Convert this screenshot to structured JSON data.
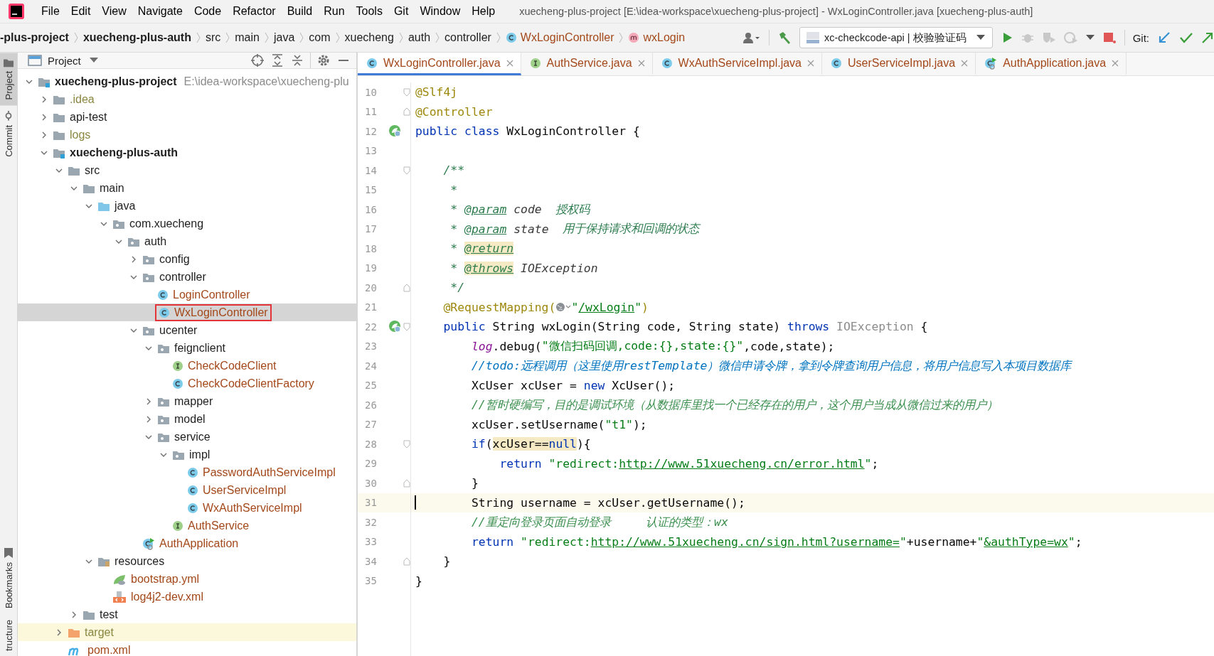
{
  "title": "xuecheng-plus-project [E:\\idea-workspace\\xuecheng-plus-project] - WxLoginController.java [xuecheng-plus-auth]",
  "menu": [
    "File",
    "Edit",
    "View",
    "Navigate",
    "Code",
    "Refactor",
    "Build",
    "Run",
    "Tools",
    "Git",
    "Window",
    "Help"
  ],
  "breadcrumbs": [
    {
      "label": "-plus-project",
      "bold": true,
      "kind": "folder"
    },
    {
      "label": "xuecheng-plus-auth",
      "bold": true,
      "kind": "folder"
    },
    {
      "label": "src",
      "bold": false,
      "kind": "folder"
    },
    {
      "label": "main",
      "bold": false,
      "kind": "folder"
    },
    {
      "label": "java",
      "bold": false,
      "kind": "folder"
    },
    {
      "label": "com",
      "bold": false,
      "kind": "folder"
    },
    {
      "label": "xuecheng",
      "bold": false,
      "kind": "folder"
    },
    {
      "label": "auth",
      "bold": false,
      "kind": "folder"
    },
    {
      "label": "controller",
      "bold": false,
      "kind": "folder"
    },
    {
      "label": "WxLoginController",
      "bold": false,
      "kind": "class"
    },
    {
      "label": "wxLogin",
      "bold": false,
      "kind": "method"
    }
  ],
  "run_config": {
    "label": "xc-checkcode-api | 校验验证码"
  },
  "git_label": "Git:",
  "tool_stripe": [
    {
      "label": "Project",
      "selected": true,
      "kind": "folder"
    },
    {
      "label": "Commit",
      "selected": false,
      "kind": "commit"
    },
    {
      "label": "Bookmarks",
      "selected": false,
      "kind": "bookmark"
    },
    {
      "label": "tructure",
      "selected": false,
      "kind": "structure"
    }
  ],
  "project_panel": {
    "title": "Project",
    "tree": [
      {
        "label": "xuecheng-plus-project",
        "path": "E:\\idea-workspace\\xuecheng-plu",
        "kind": "module",
        "bold": true,
        "ignored": false,
        "expanded": true,
        "selected": false,
        "boxed": false,
        "children": [
          {
            "label": ".idea",
            "kind": "folder",
            "bold": false,
            "ignored": true,
            "expanded": false,
            "selected": false,
            "boxed": false
          },
          {
            "label": "api-test",
            "kind": "folder",
            "bold": false,
            "ignored": false,
            "expanded": false,
            "selected": false,
            "boxed": false
          },
          {
            "label": "logs",
            "kind": "folder",
            "bold": false,
            "ignored": true,
            "expanded": false,
            "selected": false,
            "boxed": false
          },
          {
            "label": "xuecheng-plus-auth",
            "kind": "module",
            "bold": true,
            "ignored": false,
            "expanded": true,
            "selected": false,
            "boxed": false,
            "children": [
              {
                "label": "src",
                "kind": "folder",
                "bold": false,
                "ignored": false,
                "expanded": true,
                "selected": false,
                "boxed": false,
                "children": [
                  {
                    "label": "main",
                    "kind": "folder",
                    "bold": false,
                    "ignored": false,
                    "expanded": true,
                    "selected": false,
                    "boxed": false,
                    "children": [
                      {
                        "label": "java",
                        "kind": "source",
                        "bold": false,
                        "ignored": false,
                        "expanded": true,
                        "selected": false,
                        "boxed": false,
                        "children": [
                          {
                            "label": "com.xuecheng",
                            "kind": "package",
                            "bold": false,
                            "ignored": false,
                            "expanded": true,
                            "selected": false,
                            "boxed": false,
                            "children": [
                              {
                                "label": "auth",
                                "kind": "package",
                                "bold": false,
                                "ignored": false,
                                "expanded": true,
                                "selected": false,
                                "boxed": false,
                                "children": [
                                  {
                                    "label": "config",
                                    "kind": "package",
                                    "bold": false,
                                    "ignored": false,
                                    "expanded": false,
                                    "selected": false,
                                    "boxed": false
                                  },
                                  {
                                    "label": "controller",
                                    "kind": "package",
                                    "bold": false,
                                    "ignored": false,
                                    "expanded": true,
                                    "selected": false,
                                    "boxed": false,
                                    "children": [
                                      {
                                        "label": "LoginController",
                                        "kind": "class",
                                        "bold": false,
                                        "ignored": false,
                                        "selected": false,
                                        "boxed": false
                                      },
                                      {
                                        "label": "WxLoginController",
                                        "kind": "class",
                                        "bold": false,
                                        "ignored": false,
                                        "selected": true,
                                        "boxed": true
                                      }
                                    ]
                                  },
                                  {
                                    "label": "ucenter",
                                    "kind": "package",
                                    "bold": false,
                                    "ignored": false,
                                    "expanded": true,
                                    "selected": false,
                                    "boxed": false,
                                    "children": [
                                      {
                                        "label": "feignclient",
                                        "kind": "package",
                                        "bold": false,
                                        "ignored": false,
                                        "expanded": true,
                                        "selected": false,
                                        "boxed": false,
                                        "children": [
                                          {
                                            "label": "CheckCodeClient",
                                            "kind": "interface",
                                            "bold": false,
                                            "ignored": false,
                                            "selected": false,
                                            "boxed": false
                                          },
                                          {
                                            "label": "CheckCodeClientFactory",
                                            "kind": "class",
                                            "bold": false,
                                            "ignored": false,
                                            "selected": false,
                                            "boxed": false
                                          }
                                        ]
                                      },
                                      {
                                        "label": "mapper",
                                        "kind": "package",
                                        "bold": false,
                                        "ignored": false,
                                        "expanded": false,
                                        "selected": false,
                                        "boxed": false
                                      },
                                      {
                                        "label": "model",
                                        "kind": "package",
                                        "bold": false,
                                        "ignored": false,
                                        "expanded": false,
                                        "selected": false,
                                        "boxed": false
                                      },
                                      {
                                        "label": "service",
                                        "kind": "package",
                                        "bold": false,
                                        "ignored": false,
                                        "expanded": true,
                                        "selected": false,
                                        "boxed": false,
                                        "children": [
                                          {
                                            "label": "impl",
                                            "kind": "package",
                                            "bold": false,
                                            "ignored": false,
                                            "expanded": true,
                                            "selected": false,
                                            "boxed": false,
                                            "children": [
                                              {
                                                "label": "PasswordAuthServiceImpl",
                                                "kind": "class",
                                                "bold": false,
                                                "ignored": false,
                                                "selected": false,
                                                "boxed": false
                                              },
                                              {
                                                "label": "UserServiceImpl",
                                                "kind": "class",
                                                "bold": false,
                                                "ignored": false,
                                                "selected": false,
                                                "boxed": false
                                              },
                                              {
                                                "label": "WxAuthServiceImpl",
                                                "kind": "class",
                                                "bold": false,
                                                "ignored": false,
                                                "selected": false,
                                                "boxed": false
                                              }
                                            ]
                                          },
                                          {
                                            "label": "AuthService",
                                            "kind": "interface",
                                            "bold": false,
                                            "ignored": false,
                                            "selected": false,
                                            "boxed": false
                                          }
                                        ]
                                      }
                                    ]
                                  },
                                  {
                                    "label": "AuthApplication",
                                    "kind": "app",
                                    "bold": false,
                                    "ignored": false,
                                    "selected": false,
                                    "boxed": false
                                  }
                                ]
                              }
                            ]
                          }
                        ]
                      },
                      {
                        "label": "resources",
                        "kind": "resources",
                        "bold": false,
                        "ignored": false,
                        "expanded": true,
                        "selected": false,
                        "boxed": false,
                        "children": [
                          {
                            "label": "bootstrap.yml",
                            "kind": "yml",
                            "bold": false,
                            "ignored": false,
                            "selected": false,
                            "boxed": false
                          },
                          {
                            "label": "log4j2-dev.xml",
                            "kind": "xml",
                            "bold": false,
                            "ignored": false,
                            "selected": false,
                            "boxed": false
                          }
                        ]
                      }
                    ]
                  },
                  {
                    "label": "test",
                    "kind": "folder",
                    "bold": false,
                    "ignored": false,
                    "expanded": false,
                    "selected": false,
                    "boxed": false
                  }
                ]
              },
              {
                "label": "target",
                "kind": "excluded",
                "bold": false,
                "ignored": true,
                "expanded": false,
                "selected": false,
                "boxed": false
              },
              {
                "label": "pom.xml",
                "kind": "maven",
                "bold": false,
                "ignored": false,
                "selected": false,
                "boxed": false
              }
            ]
          }
        ]
      }
    ]
  },
  "editor": {
    "tabs": [
      {
        "label": "WxLoginController.java",
        "kind": "class",
        "selected": true
      },
      {
        "label": "AuthService.java",
        "kind": "interface",
        "selected": false
      },
      {
        "label": "WxAuthServiceImpl.java",
        "kind": "class",
        "selected": false
      },
      {
        "label": "UserServiceImpl.java",
        "kind": "class",
        "selected": false
      },
      {
        "label": "AuthApplication.java",
        "kind": "app",
        "selected": false
      }
    ],
    "lines": [
      {
        "n": "10",
        "bean": false,
        "fold_start": true,
        "fold_end": false,
        "current": false,
        "tokens": [
          {
            "kind": "ann",
            "text": "@Slf4j"
          }
        ]
      },
      {
        "n": "11",
        "bean": false,
        "fold_start": false,
        "fold_end": true,
        "current": false,
        "tokens": [
          {
            "kind": "ann",
            "text": "@Controller"
          }
        ]
      },
      {
        "n": "12",
        "bean": true,
        "fold_start": false,
        "fold_end": false,
        "current": false,
        "tokens": [
          {
            "kind": "kw",
            "text": "public class "
          },
          {
            "kind": "p",
            "text": "WxLoginController {"
          }
        ]
      },
      {
        "n": "13",
        "bean": false,
        "fold_start": false,
        "fold_end": false,
        "current": false
      },
      {
        "n": "14",
        "bean": false,
        "fold_start": true,
        "fold_end": false,
        "current": false,
        "tokens": [
          {
            "kind": "doc",
            "text": "    /**"
          }
        ]
      },
      {
        "n": "15",
        "bean": false,
        "fold_start": false,
        "fold_end": false,
        "current": false,
        "tokens": [
          {
            "kind": "doc",
            "text": "     *"
          }
        ]
      },
      {
        "n": "16",
        "bean": false,
        "fold_start": false,
        "fold_end": false,
        "current": false,
        "tokens": [
          {
            "kind": "doc",
            "text": "     * "
          },
          {
            "kind": "dtag",
            "text": "@param"
          },
          {
            "kind": "dparam",
            "text": " code"
          },
          {
            "kind": "doc",
            "text": "  授权码"
          }
        ]
      },
      {
        "n": "17",
        "bean": false,
        "fold_start": false,
        "fold_end": false,
        "current": false,
        "tokens": [
          {
            "kind": "doc",
            "text": "     * "
          },
          {
            "kind": "dtag",
            "text": "@param"
          },
          {
            "kind": "dparam",
            "text": " state"
          },
          {
            "kind": "doc",
            "text": "  用于保持请求和回调的状态"
          }
        ]
      },
      {
        "n": "18",
        "bean": false,
        "fold_start": false,
        "fold_end": false,
        "current": false,
        "tokens": [
          {
            "kind": "doc",
            "text": "     * "
          },
          {
            "kind": "dtaghl",
            "text": "@return"
          }
        ]
      },
      {
        "n": "19",
        "bean": false,
        "fold_start": false,
        "fold_end": false,
        "current": false,
        "tokens": [
          {
            "kind": "doc",
            "text": "     * "
          },
          {
            "kind": "dtaghl",
            "text": "@throws"
          },
          {
            "kind": "dparam",
            "text": " IOException"
          }
        ]
      },
      {
        "n": "20",
        "bean": false,
        "fold_start": false,
        "fold_end": true,
        "current": false,
        "tokens": [
          {
            "kind": "doc",
            "text": "     */"
          }
        ]
      },
      {
        "n": "21",
        "bean": false,
        "fold_start": false,
        "fold_end": false,
        "current": false,
        "tokens": [
          {
            "kind": "ann",
            "text": "    @RequestMapping("
          },
          {
            "kind": "icon"
          },
          {
            "kind": "str",
            "text": "\""
          },
          {
            "kind": "link",
            "text": "/wxLogin"
          },
          {
            "kind": "str",
            "text": "\""
          },
          {
            "kind": "ann",
            "text": ")"
          }
        ]
      },
      {
        "n": "22",
        "bean": true,
        "fold_start": true,
        "fold_end": false,
        "current": false,
        "tokens": [
          {
            "kind": "kw",
            "text": "    public "
          },
          {
            "kind": "p",
            "text": "String wxLogin(String code, String state) "
          },
          {
            "kind": "kw",
            "text": "throws "
          },
          {
            "kind": "gray",
            "text": "IOException "
          },
          {
            "kind": "p",
            "text": "{"
          }
        ]
      },
      {
        "n": "23",
        "bean": false,
        "fold_start": false,
        "fold_end": false,
        "current": false,
        "tokens": [
          {
            "kind": "field",
            "text": "        log"
          },
          {
            "kind": "p",
            "text": ".debug("
          },
          {
            "kind": "str",
            "text": "\"微信扫码回调,code:{},state:{}\""
          },
          {
            "kind": "p",
            "text": ",code,state);"
          }
        ]
      },
      {
        "n": "24",
        "bean": false,
        "fold_start": false,
        "fold_end": false,
        "current": false,
        "tokens": [
          {
            "kind": "todo",
            "text": "        //todo:远程调用（这里使用restTemplate）微信申请令牌，拿到令牌查询用户信息，将用户信息写入本项目数据库"
          }
        ]
      },
      {
        "n": "25",
        "bean": false,
        "fold_start": false,
        "fold_end": false,
        "current": false,
        "tokens": [
          {
            "kind": "p",
            "text": "        XcUser xcUser = "
          },
          {
            "kind": "kw",
            "text": "new "
          },
          {
            "kind": "p",
            "text": "XcUser();"
          }
        ]
      },
      {
        "n": "26",
        "bean": false,
        "fold_start": false,
        "fold_end": false,
        "current": false,
        "tokens": [
          {
            "kind": "cmt",
            "text": "        //暂时硬编写，目的是调试环境（从数据库里找一个已经存在的用户，这个用户当成从微信过来的用户）"
          }
        ]
      },
      {
        "n": "27",
        "bean": false,
        "fold_start": false,
        "fold_end": false,
        "current": false,
        "tokens": [
          {
            "kind": "p",
            "text": "        xcUser.setUsername("
          },
          {
            "kind": "str",
            "text": "\"t1\""
          },
          {
            "kind": "p",
            "text": ");"
          }
        ]
      },
      {
        "n": "28",
        "bean": false,
        "fold_start": true,
        "fold_end": false,
        "current": false,
        "tokens": [
          {
            "kind": "kw",
            "text": "        if"
          },
          {
            "kind": "p",
            "text": "("
          },
          {
            "kind": "hl",
            "text": "xcUser=="
          },
          {
            "kind": "hlkw",
            "text": "null"
          },
          {
            "kind": "p",
            "text": "){"
          }
        ]
      },
      {
        "n": "29",
        "bean": false,
        "fold_start": false,
        "fold_end": false,
        "current": false,
        "tokens": [
          {
            "kind": "kw",
            "text": "            return "
          },
          {
            "kind": "str",
            "text": "\"redirect:"
          },
          {
            "kind": "link",
            "text": "http://www.51xuecheng.cn/error.html"
          },
          {
            "kind": "str",
            "text": "\""
          },
          {
            "kind": "p",
            "text": ";"
          }
        ]
      },
      {
        "n": "30",
        "bean": false,
        "fold_start": false,
        "fold_end": true,
        "current": false,
        "tokens": [
          {
            "kind": "p",
            "text": "        }"
          }
        ]
      },
      {
        "n": "31",
        "bean": false,
        "fold_start": false,
        "fold_end": false,
        "current": true,
        "tokens": [
          {
            "kind": "p",
            "text": "        String username = xcUser.getUsername();"
          }
        ]
      },
      {
        "n": "32",
        "bean": false,
        "fold_start": false,
        "fold_end": false,
        "current": false,
        "tokens": [
          {
            "kind": "cmt",
            "text": "        //重定向登录页面自动登录     认证的类型：wx"
          }
        ]
      },
      {
        "n": "33",
        "bean": false,
        "fold_start": false,
        "fold_end": false,
        "current": false,
        "tokens": [
          {
            "kind": "kw",
            "text": "        return "
          },
          {
            "kind": "str",
            "text": "\"redirect:"
          },
          {
            "kind": "link",
            "text": "http://www.51xuecheng.cn/sign.html?username="
          },
          {
            "kind": "str",
            "text": "\""
          },
          {
            "kind": "p",
            "text": "+username+"
          },
          {
            "kind": "str",
            "text": "\""
          },
          {
            "kind": "link",
            "text": "&authType=wx"
          },
          {
            "kind": "str",
            "text": "\""
          },
          {
            "kind": "p",
            "text": ";"
          }
        ]
      },
      {
        "n": "34",
        "bean": false,
        "fold_start": false,
        "fold_end": true,
        "current": false,
        "tokens": [
          {
            "kind": "p",
            "text": "    }"
          }
        ]
      },
      {
        "n": "35",
        "bean": false,
        "fold_start": false,
        "fold_end": false,
        "current": false,
        "tokens": [
          {
            "kind": "p",
            "text": "}"
          }
        ]
      }
    ]
  }
}
